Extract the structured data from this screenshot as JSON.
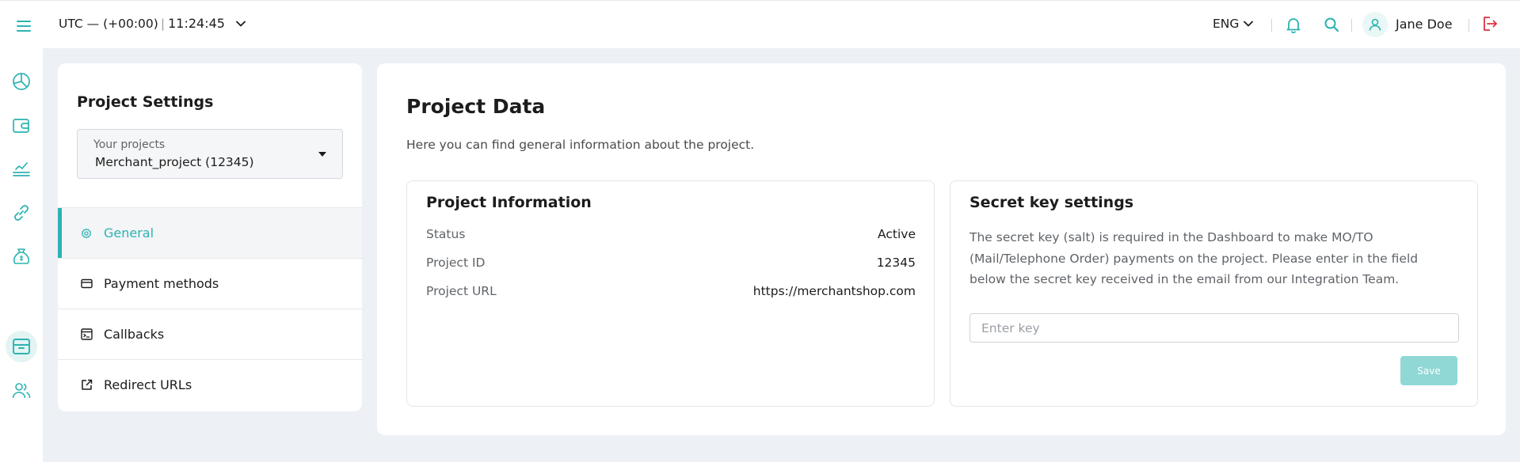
{
  "topbar": {
    "timezone": "UTC — (+00:00)",
    "time": "11:24:45",
    "language": "ENG",
    "user_name": "Jane Doe"
  },
  "sidebar": {
    "items": [
      {
        "icon": "pie-chart-icon"
      },
      {
        "icon": "wallet-icon"
      },
      {
        "icon": "payout-icon"
      },
      {
        "icon": "link-icon"
      },
      {
        "icon": "money-bag-icon"
      },
      {
        "icon": "archive-box-icon",
        "active": true
      },
      {
        "icon": "users-icon"
      }
    ]
  },
  "settings": {
    "title": "Project Settings",
    "project_select": {
      "label": "Your projects",
      "value": "Merchant_project (12345)"
    },
    "nav": [
      {
        "label": "General",
        "icon": "gear-icon",
        "active": true
      },
      {
        "label": "Payment methods",
        "icon": "card-icon"
      },
      {
        "label": "Callbacks",
        "icon": "terminal-icon"
      },
      {
        "label": "Redirect URLs",
        "icon": "external-link-icon"
      }
    ]
  },
  "main": {
    "title": "Project Data",
    "subtitle": "Here you can find general information about the project.",
    "project_info": {
      "title": "Project Information",
      "rows": [
        {
          "key": "Status",
          "value": "Active"
        },
        {
          "key": "Project ID",
          "value": "12345"
        },
        {
          "key": "Project URL",
          "value": "https://merchantshop.com"
        }
      ]
    },
    "secret_key": {
      "title": "Secret key settings",
      "description": "The secret key (salt) is required in the Dashboard to make MO/TO (Mail/Telephone Order) payments on the project. Please enter in the field below the secret key received in the email from our Integration Team.",
      "input_placeholder": "Enter key",
      "input_value": "",
      "save_label": "Save"
    }
  },
  "colors": {
    "accent": "#2bb3b1",
    "save_button": "#8fd8d6",
    "logout": "#d9343f",
    "page_background": "#edf0f5"
  }
}
